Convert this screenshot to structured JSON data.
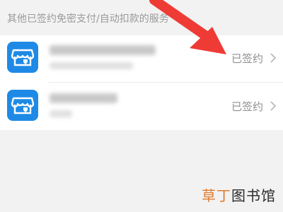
{
  "header": {
    "text": "其他已签约免密支付/自动扣款的服务"
  },
  "services": [
    {
      "status": "已签约",
      "icon": "store-icon"
    },
    {
      "status": "已签约",
      "icon": "store-icon"
    }
  ],
  "watermark": {
    "part1": "草丁",
    "part2": "图书馆"
  },
  "colors": {
    "icon_bg": "#1e8ae6",
    "arrow": "#ef3b36",
    "status": "#8f8f8f"
  }
}
